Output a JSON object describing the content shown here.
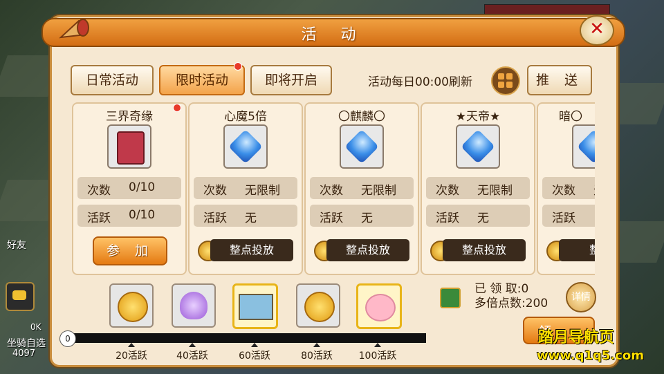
{
  "window": {
    "title": "活 动"
  },
  "tabs": [
    {
      "label": "日常活动",
      "active": false
    },
    {
      "label": "限时活动",
      "active": true
    },
    {
      "label": "即将开启",
      "active": false
    }
  ],
  "header": {
    "refresh_text": "活动每日00:00刷新",
    "push_label": "推 送"
  },
  "cards": [
    {
      "title": "三界奇缘",
      "icon": "book-icon",
      "count_label": "次数",
      "count_value": "0/10",
      "active_label": "活跃",
      "active_value": "0/10",
      "action": "参 加"
    },
    {
      "title": "心魔5倍",
      "icon": "gem-icon",
      "count_label": "次数",
      "count_value": "无限制",
      "active_label": "活跃",
      "active_value": "无",
      "action": "整点投放"
    },
    {
      "title": "〇麒麟〇",
      "icon": "gem-icon",
      "count_label": "次数",
      "count_value": "无限制",
      "active_label": "活跃",
      "active_value": "无",
      "action": "整点投放"
    },
    {
      "title": "★天帝★",
      "icon": "gem-icon",
      "count_label": "次数",
      "count_value": "无限制",
      "active_label": "活跃",
      "active_value": "无",
      "action": "整点投放"
    },
    {
      "title": "暗〇",
      "icon": "gem-icon",
      "count_label": "次数",
      "count_value": "无",
      "active_label": "活跃",
      "active_value": "",
      "action": "整点"
    }
  ],
  "progress": {
    "start": "0",
    "milestones": [
      "20活跃",
      "40活跃",
      "60活跃",
      "80活跃",
      "100活跃"
    ],
    "rewards": [
      "coin-icon",
      "bag-icon",
      "scroll-icon",
      "coin-icon",
      "pig-icon"
    ]
  },
  "stats": {
    "claimed": "已 领 取:0",
    "multiplier": "多倍点数:200",
    "detail": "详情",
    "claim": "领"
  },
  "side": {
    "friend": "好友",
    "mount": "坐骑自选",
    "num": "4097",
    "ok": "0K"
  },
  "watermark": {
    "line1": "踏月导航页",
    "line2": "www.q1q5.com"
  }
}
